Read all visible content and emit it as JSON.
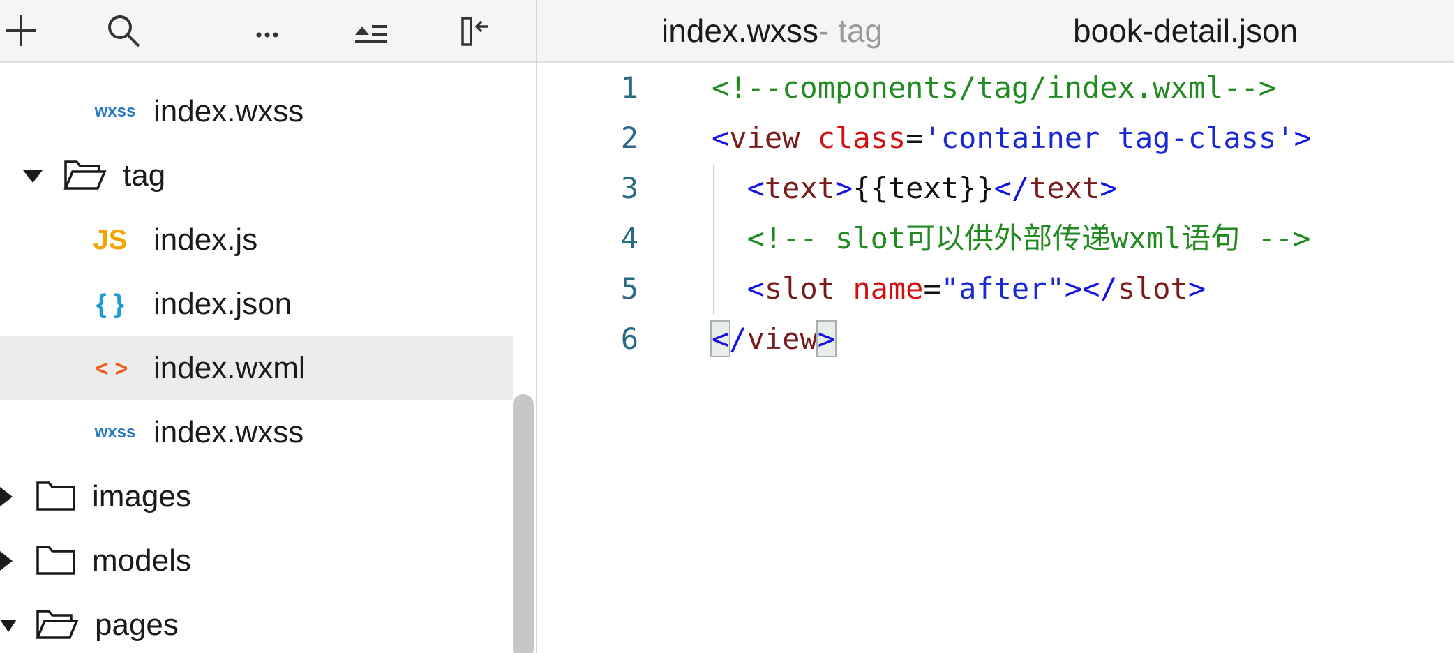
{
  "sidebar": {
    "toolbar": {
      "icons": [
        "add-icon",
        "search-icon",
        "more-icon",
        "collapse-all-icon",
        "hide-sidebar-icon"
      ]
    },
    "tree": [
      {
        "name": "index.wxss",
        "type": "wxss",
        "icon_text": "wxss",
        "expanded": null
      },
      {
        "name": "tag",
        "type": "folder",
        "expanded": true
      },
      {
        "name": "index.js",
        "type": "js",
        "icon_text": "JS"
      },
      {
        "name": "index.json",
        "type": "json",
        "icon_text": "{ }"
      },
      {
        "name": "index.wxml",
        "type": "wxml",
        "icon_text": "< >",
        "selected": true
      },
      {
        "name": "index.wxss",
        "type": "wxss",
        "icon_text": "wxss"
      },
      {
        "name": "images",
        "type": "folder",
        "expanded": false
      },
      {
        "name": "models",
        "type": "folder",
        "expanded": false
      },
      {
        "name": "pages",
        "type": "folder",
        "expanded": true
      }
    ]
  },
  "editor": {
    "tabs": [
      {
        "label": "index.wxss",
        "sublabel": " - tag"
      },
      {
        "label": "book-detail.json",
        "sublabel": ""
      }
    ],
    "line_numbers": [
      "1",
      "2",
      "3",
      "4",
      "5",
      "6"
    ],
    "lines": [
      [
        {
          "t": "<!--components/tag/index.wxml-->",
          "c": "com"
        }
      ],
      [
        {
          "t": "<",
          "c": "tag"
        },
        {
          "t": "view",
          "c": "name"
        },
        {
          "t": " ",
          "c": "txt"
        },
        {
          "t": "class",
          "c": "attr"
        },
        {
          "t": "=",
          "c": "txt"
        },
        {
          "t": "'container tag-class'",
          "c": "str"
        },
        {
          "t": ">",
          "c": "tag"
        }
      ],
      [
        {
          "t": "  ",
          "c": "txt"
        },
        {
          "t": "<",
          "c": "tag"
        },
        {
          "t": "text",
          "c": "name"
        },
        {
          "t": ">",
          "c": "tag"
        },
        {
          "t": "{{text}}",
          "c": "txt"
        },
        {
          "t": "</",
          "c": "tag"
        },
        {
          "t": "text",
          "c": "name"
        },
        {
          "t": ">",
          "c": "tag"
        }
      ],
      [
        {
          "t": "  ",
          "c": "txt"
        },
        {
          "t": "<!-- slot可以供外部传递wxml语句 -->",
          "c": "com"
        }
      ],
      [
        {
          "t": "  ",
          "c": "txt"
        },
        {
          "t": "<",
          "c": "tag"
        },
        {
          "t": "slot",
          "c": "name"
        },
        {
          "t": " ",
          "c": "txt"
        },
        {
          "t": "name",
          "c": "attr"
        },
        {
          "t": "=",
          "c": "txt"
        },
        {
          "t": "\"after\"",
          "c": "str"
        },
        {
          "t": "></",
          "c": "tag"
        },
        {
          "t": "slot",
          "c": "name"
        },
        {
          "t": ">",
          "c": "tag"
        }
      ],
      [
        {
          "t": "<",
          "c": "tag",
          "box": true
        },
        {
          "t": "/",
          "c": "tag"
        },
        {
          "t": "view",
          "c": "name"
        },
        {
          "t": ">",
          "c": "tag",
          "box": true
        }
      ]
    ],
    "annotation_color": "#e5512d"
  }
}
